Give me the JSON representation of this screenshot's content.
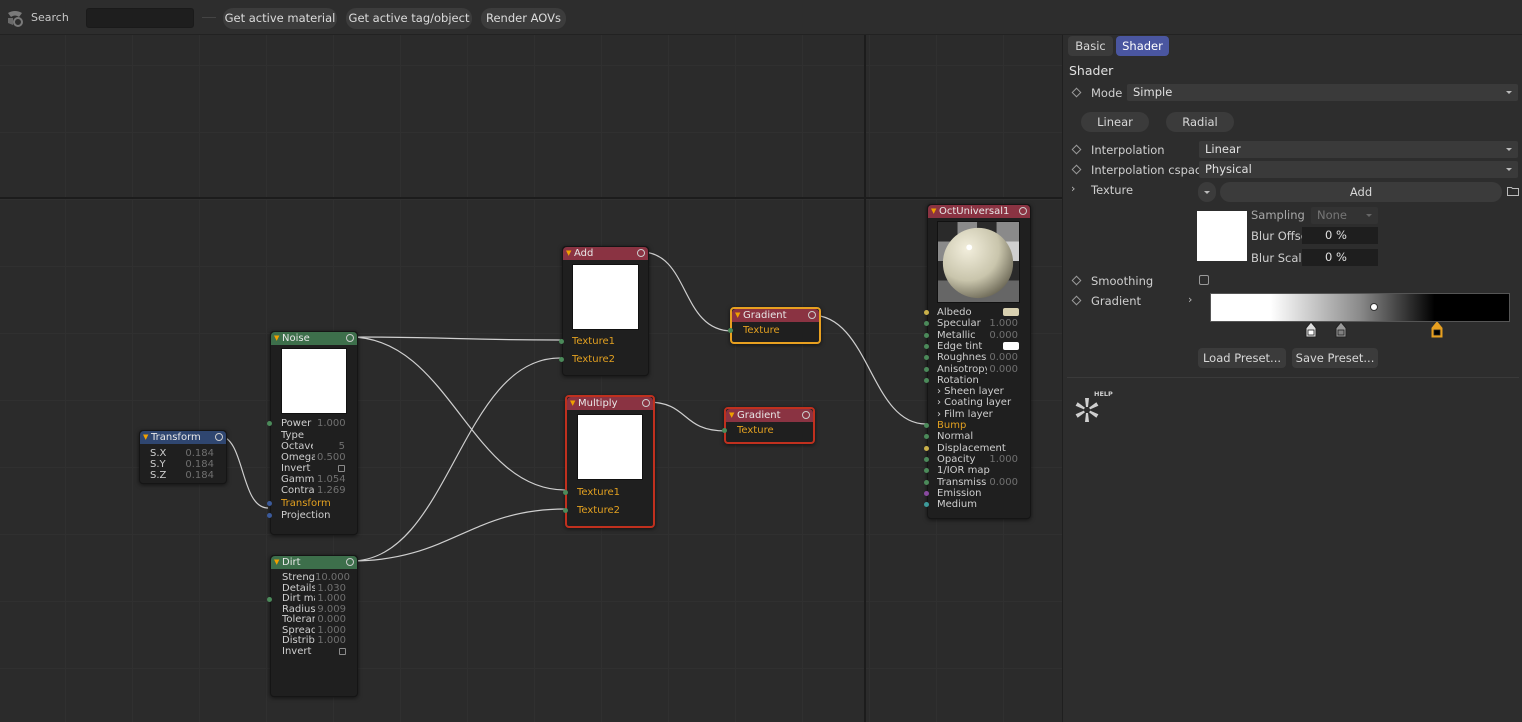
{
  "toolbar": {
    "search_label": "Search",
    "search_value": "",
    "buttons": [
      "Get active material",
      "Get active tag/object",
      "Render AOVs"
    ]
  },
  "graph": {
    "nodes": {
      "transform": {
        "title": "Transform",
        "params": [
          {
            "label": "S.X",
            "value": "0.184"
          },
          {
            "label": "S.Y",
            "value": "0.184"
          },
          {
            "label": "S.Z",
            "value": "0.184"
          }
        ]
      },
      "noise": {
        "title": "Noise",
        "params": [
          {
            "label": "Power",
            "value": "1.000"
          },
          {
            "label": "Type",
            "value": ""
          },
          {
            "label": "Octave",
            "value": "5"
          },
          {
            "label": "Omega",
            "value": "0.500"
          },
          {
            "label": "Invert",
            "value": ""
          },
          {
            "label": "Gamma",
            "value": "1.054"
          },
          {
            "label": "Contras",
            "value": "1.269"
          },
          {
            "label": "Transform",
            "value": ""
          },
          {
            "label": "Projection",
            "value": ""
          }
        ]
      },
      "dirt": {
        "title": "Dirt",
        "params": [
          {
            "label": "Strength",
            "value": "10.000"
          },
          {
            "label": "Details",
            "value": "1.030"
          },
          {
            "label": "Dirt ma",
            "value": "1.000"
          },
          {
            "label": "Radius",
            "value": "9.009"
          },
          {
            "label": "Toleran",
            "value": "0.000"
          },
          {
            "label": "Spread",
            "value": "1.000"
          },
          {
            "label": "Distribu",
            "value": "1.000"
          },
          {
            "label": "Invert",
            "value": ""
          }
        ]
      },
      "add": {
        "title": "Add",
        "inputs": [
          "Texture1",
          "Texture2"
        ]
      },
      "multiply": {
        "title": "Multiply",
        "inputs": [
          "Texture1",
          "Texture2"
        ]
      },
      "gradient1": {
        "title": "Gradient",
        "inputs": [
          "Texture"
        ]
      },
      "gradient2": {
        "title": "Gradient",
        "inputs": [
          "Texture"
        ]
      },
      "universal": {
        "title": "OctUniversal1",
        "params": [
          {
            "label": "Albedo",
            "value": ""
          },
          {
            "label": "Specular",
            "value": "1.000"
          },
          {
            "label": "Metallic",
            "value": "0.000"
          },
          {
            "label": "Edge tint",
            "value": ""
          },
          {
            "label": "Roughness",
            "value": "0.000"
          },
          {
            "label": "Anisotropy",
            "value": "0.000"
          },
          {
            "label": "Rotation",
            "value": ""
          },
          {
            "label": "› Sheen layer",
            "value": ""
          },
          {
            "label": "› Coating layer",
            "value": ""
          },
          {
            "label": "› Film layer",
            "value": ""
          },
          {
            "label": "Bump",
            "value": ""
          },
          {
            "label": "Normal",
            "value": ""
          },
          {
            "label": "Displacement",
            "value": ""
          },
          {
            "label": "Opacity",
            "value": "1.000"
          },
          {
            "label": "1/IOR map",
            "value": ""
          },
          {
            "label": "Transmissi",
            "value": "0.000"
          },
          {
            "label": "Emission",
            "value": ""
          },
          {
            "label": "Medium",
            "value": ""
          }
        ]
      }
    }
  },
  "panel": {
    "tabs": [
      "Basic",
      "Shader"
    ],
    "section_title": "Shader",
    "mode_label": "Mode",
    "mode_value": "Simple",
    "gradient_types": [
      "Linear",
      "Radial"
    ],
    "interpolation_label": "Interpolation",
    "interpolation_value": "Linear",
    "interp_cspace_label": "Interpolation cspace",
    "interp_cspace_value": "Physical",
    "texture_label": "Texture",
    "add_label": "Add",
    "sampling_label": "Sampling",
    "sampling_value": "None",
    "blur_offset_label": "Blur Offset",
    "blur_offset_value": "0 %",
    "blur_scale_label": "Blur Scale",
    "blur_scale_value": "0 %",
    "smoothing_label": "Smoothing",
    "gradient_label": "Gradient",
    "load_preset": "Load Preset...",
    "save_preset": "Save Preset...",
    "help_label": "HELP"
  },
  "colors": {
    "accent": "#4a56a0",
    "selection_orange": "#e8a020",
    "selection_red": "#c0301e"
  }
}
